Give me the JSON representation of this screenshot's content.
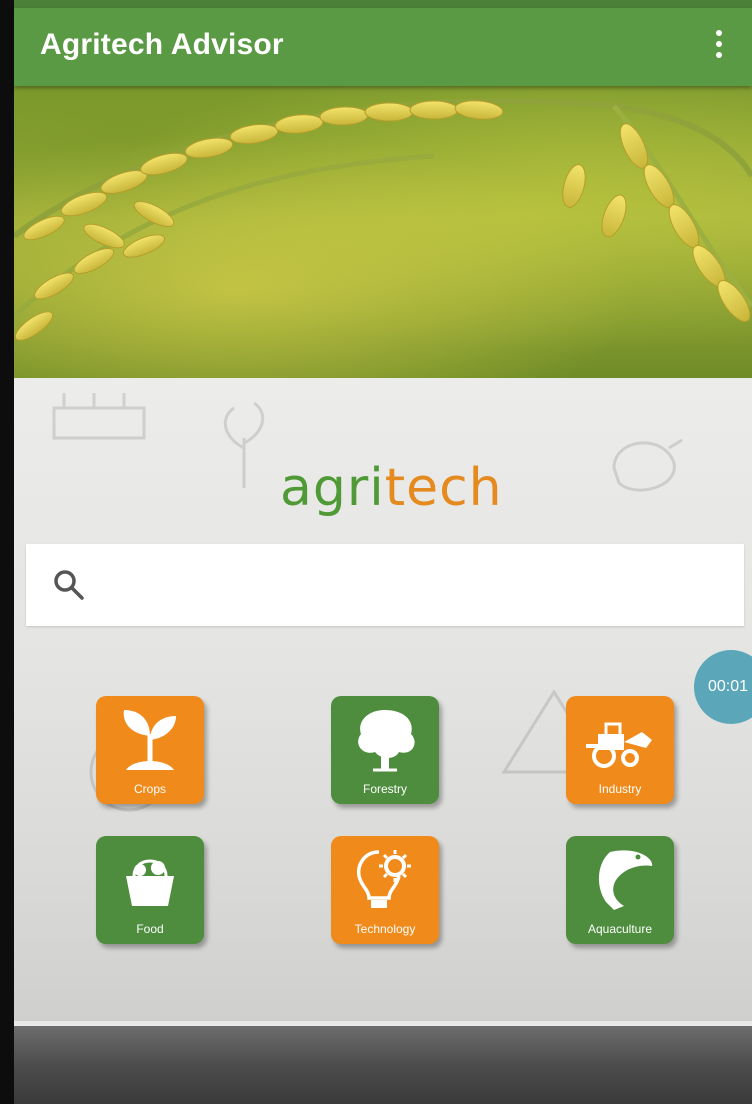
{
  "app": {
    "title": "Agritech Advisor"
  },
  "logo": {
    "part1": "agri",
    "part2": "tech"
  },
  "search": {
    "placeholder": "",
    "value": ""
  },
  "categories": [
    {
      "label": "Crops",
      "icon": "sprout-icon",
      "color": "#f08a1a"
    },
    {
      "label": "Forestry",
      "icon": "tree-icon",
      "color": "#4d8d3d"
    },
    {
      "label": "Industry",
      "icon": "tractor-icon",
      "color": "#f08a1a"
    },
    {
      "label": "Food",
      "icon": "basket-icon",
      "color": "#4d8d3d"
    },
    {
      "label": "Technology",
      "icon": "lightbulb-gear-icon",
      "color": "#f08a1a"
    },
    {
      "label": "Aquaculture",
      "icon": "fish-icon",
      "color": "#4d8d3d"
    }
  ],
  "timer": {
    "text": "00:01"
  },
  "colors": {
    "appbar": "#5b9a45",
    "accent_orange": "#f08a1a",
    "accent_green": "#4d8d3d"
  }
}
